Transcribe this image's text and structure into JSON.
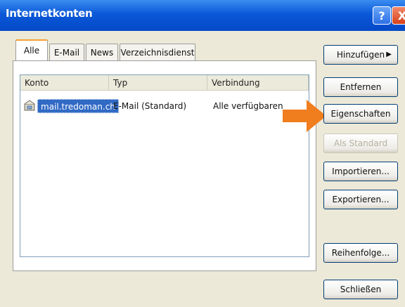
{
  "window": {
    "title": "Internetkonten",
    "help_label": "?",
    "close_label": "X"
  },
  "tabs": [
    "Alle",
    "E-Mail",
    "News",
    "Verzeichnisdienst"
  ],
  "list": {
    "columns": [
      "Konto",
      "Typ",
      "Verbindung"
    ],
    "rows": [
      {
        "konto": "mail.tredoman.ch",
        "typ": "E-Mail (Standard)",
        "verbindung": "Alle verfügbaren"
      }
    ]
  },
  "buttons": {
    "add": "Hinzufügen",
    "add_arrow": "▶",
    "remove": "Entfernen",
    "properties": "Eigenschaften",
    "as_default": "Als Standard",
    "import": "Importieren...",
    "export": "Exportieren...",
    "order": "Reihenfolge...",
    "close": "Schließen"
  },
  "colors": {
    "titlebar": "#0a58d8",
    "selection": "#316ac5",
    "highlight_arrow": "#f07d1e"
  },
  "icons": {
    "account": "mail-account-icon",
    "hint": "orange-arrow-icon"
  }
}
